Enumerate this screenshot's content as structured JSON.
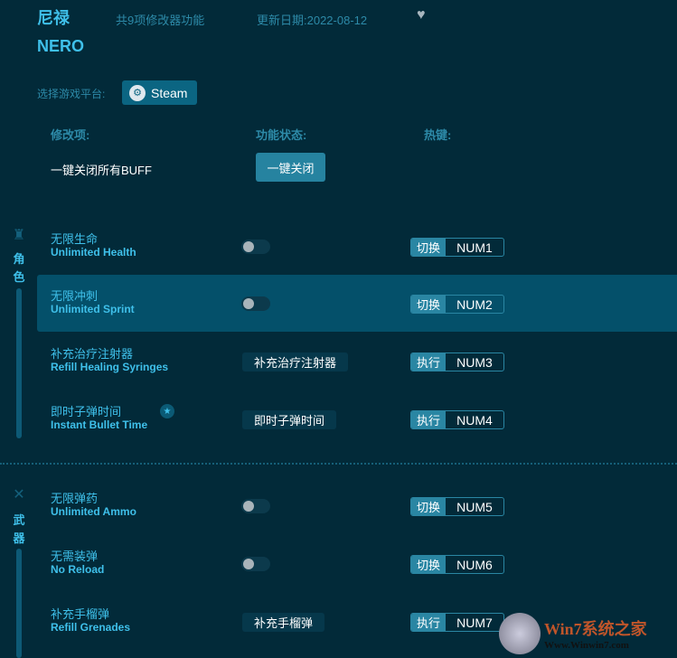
{
  "header": {
    "title": "尼禄",
    "subtitle": "NERO",
    "feature_count": "共9项修改器功能",
    "update_date": "更新日期:2022-08-12",
    "favorite_icon": "heart-icon"
  },
  "platform": {
    "label": "选择游戏平台:",
    "button": "Steam"
  },
  "columns": {
    "item": "修改项:",
    "status": "功能状态:",
    "hotkey": "热键:"
  },
  "global": {
    "label": "一键关闭所有BUFF",
    "button": "一键关闭"
  },
  "categories": [
    {
      "name_chars": [
        "角",
        "色"
      ]
    },
    {
      "name_chars": [
        "武",
        "器"
      ]
    }
  ],
  "rows": [
    {
      "zh": "无限生命",
      "en": "Unlimited Health",
      "type": "toggle",
      "key_type": "切换",
      "key": "NUM1"
    },
    {
      "zh": "无限冲刺",
      "en": "Unlimited Sprint",
      "type": "toggle",
      "key_type": "切换",
      "key": "NUM2"
    },
    {
      "zh": "补充治疗注射器",
      "en": "Refill Healing Syringes",
      "type": "action",
      "action": "补充治疗注射器",
      "key_type": "执行",
      "key": "NUM3"
    },
    {
      "zh": "即时子弹时间",
      "en": "Instant Bullet Time",
      "type": "action",
      "action": "即时子弹时间",
      "key_type": "执行",
      "key": "NUM4"
    },
    {
      "zh": "无限弹药",
      "en": "Unlimited Ammo",
      "type": "toggle",
      "key_type": "切换",
      "key": "NUM5"
    },
    {
      "zh": "无需装弹",
      "en": "No Reload",
      "type": "toggle",
      "key_type": "切换",
      "key": "NUM6"
    },
    {
      "zh": "补充手榴弹",
      "en": "Refill Grenades",
      "type": "action",
      "action": "补充手榴弹",
      "key_type": "执行",
      "key": "NUM7"
    }
  ],
  "watermark": {
    "brand": "Win7系统之家",
    "url": "Www.Winwin7.com"
  },
  "colors": {
    "background": "#022a39",
    "accent": "#3fc0ea",
    "highlight": "#04506a",
    "hotkey": "#2a86a3"
  }
}
